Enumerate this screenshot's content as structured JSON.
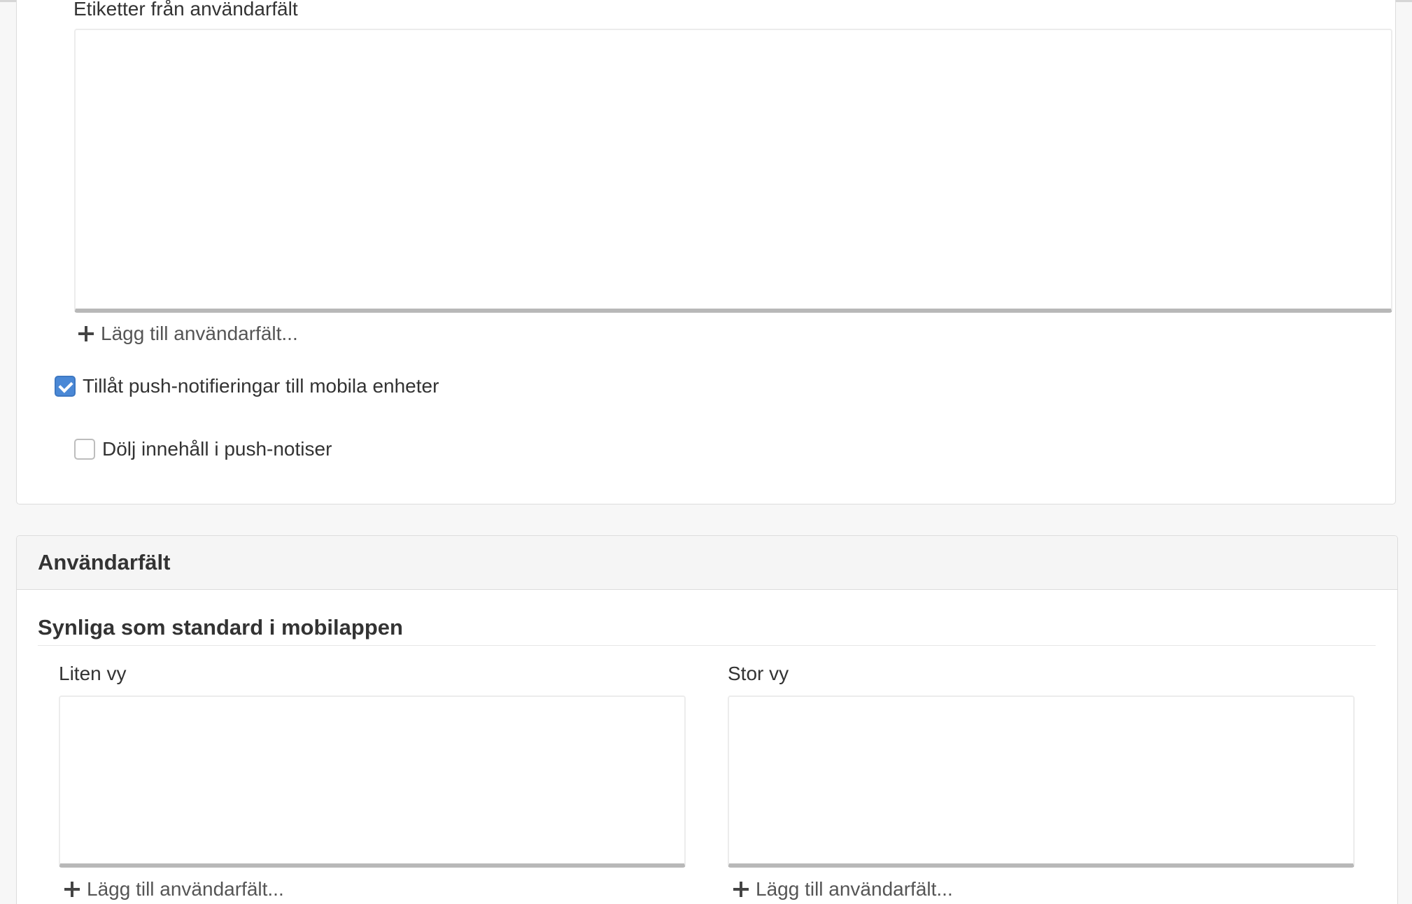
{
  "notifications": {
    "labels_field_title": "Etiketter från användarfält",
    "add_user_field_label": "Lägg till användarfält...",
    "allow_push": {
      "label": "Tillåt push-notifieringar till mobila enheter",
      "checked": true
    },
    "hide_content": {
      "label": "Dölj innehåll i push-notiser",
      "checked": false
    }
  },
  "user_fields": {
    "panel_title": "Användarfält",
    "section_title": "Synliga som standard i mobilappen",
    "small_view": {
      "label": "Liten vy",
      "add_label": "Lägg till användarfält..."
    },
    "large_view": {
      "label": "Stor vy",
      "add_label": "Lägg till användarfält..."
    }
  },
  "colors": {
    "accent": "#4a88d6",
    "panel_header_bg": "#f5f5f5",
    "page_bg": "#f7f7f7"
  }
}
